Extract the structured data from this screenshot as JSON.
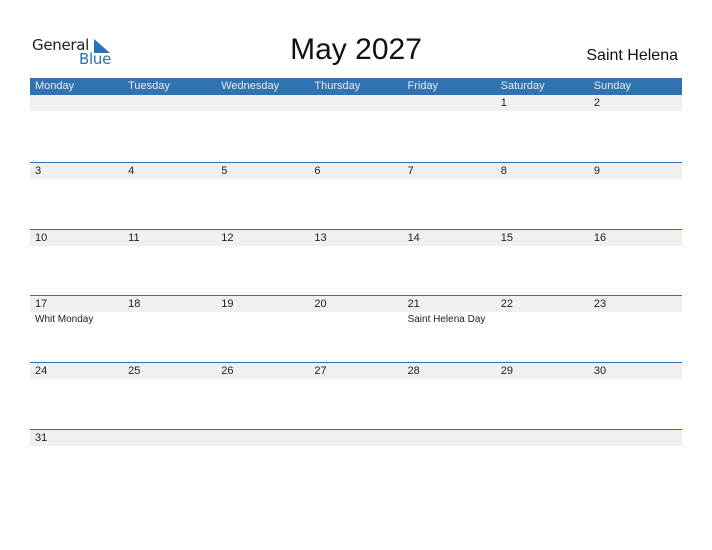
{
  "logo": {
    "line1": "General",
    "line2": "Blue",
    "icon": "triangle-flag-icon"
  },
  "title": "May 2027",
  "country": "Saint Helena",
  "colors": {
    "accent": "#2f73b3",
    "strip": "#f0f0f0"
  },
  "weekdays": [
    "Monday",
    "Tuesday",
    "Wednesday",
    "Thursday",
    "Friday",
    "Saturday",
    "Sunday"
  ],
  "weeks": [
    [
      {
        "d": ""
      },
      {
        "d": ""
      },
      {
        "d": ""
      },
      {
        "d": ""
      },
      {
        "d": ""
      },
      {
        "d": "1"
      },
      {
        "d": "2"
      }
    ],
    [
      {
        "d": "3"
      },
      {
        "d": "4"
      },
      {
        "d": "5"
      },
      {
        "d": "6"
      },
      {
        "d": "7"
      },
      {
        "d": "8"
      },
      {
        "d": "9"
      }
    ],
    [
      {
        "d": "10"
      },
      {
        "d": "11"
      },
      {
        "d": "12"
      },
      {
        "d": "13"
      },
      {
        "d": "14"
      },
      {
        "d": "15"
      },
      {
        "d": "16"
      }
    ],
    [
      {
        "d": "17",
        "e": "Whit Monday"
      },
      {
        "d": "18"
      },
      {
        "d": "19"
      },
      {
        "d": "20"
      },
      {
        "d": "21",
        "e": "Saint Helena Day"
      },
      {
        "d": "22"
      },
      {
        "d": "23"
      }
    ],
    [
      {
        "d": "24"
      },
      {
        "d": "25"
      },
      {
        "d": "26"
      },
      {
        "d": "27"
      },
      {
        "d": "28"
      },
      {
        "d": "29"
      },
      {
        "d": "30"
      }
    ],
    [
      {
        "d": "31"
      },
      {
        "d": ""
      },
      {
        "d": ""
      },
      {
        "d": ""
      },
      {
        "d": ""
      },
      {
        "d": ""
      },
      {
        "d": ""
      }
    ]
  ]
}
